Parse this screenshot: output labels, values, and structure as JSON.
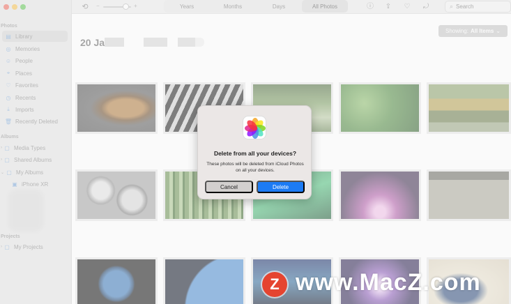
{
  "sidebar": {
    "sections": {
      "photos": "Photos",
      "albums": "Albums",
      "projects": "Projects"
    },
    "items": {
      "library": "Library",
      "memories": "Memories",
      "people": "People",
      "places": "Places",
      "favorites": "Favorites",
      "recents": "Recents",
      "imports": "Imports",
      "recently_deleted": "Recently Deleted",
      "media_types": "Media Types",
      "shared_albums": "Shared Albums",
      "my_albums": "My Albums",
      "my_albums_child": "iPhone XR",
      "my_projects": "My Projects"
    }
  },
  "toolbar": {
    "tabs": [
      "Years",
      "Months",
      "Days",
      "All Photos"
    ],
    "selected_tab": "All Photos",
    "search_placeholder": "Search",
    "zoom_level": 0.8
  },
  "main": {
    "date_prefix": "20 Ja",
    "showing_label": "Showing:",
    "showing_value": "All Items"
  },
  "dialog": {
    "app_icon": "photos-app-icon",
    "title": "Delete from all your devices?",
    "message": "These photos will be deleted from iCloud Photos on all your devices.",
    "cancel_label": "Cancel",
    "delete_label": "Delete"
  },
  "watermark": {
    "logo_letter": "Z",
    "text": "www.MacZ.com"
  },
  "colors": {
    "primary_button": "#1c7bf4",
    "dialog_bg": "#ebe7e6",
    "watermark_red": "#e54430"
  }
}
